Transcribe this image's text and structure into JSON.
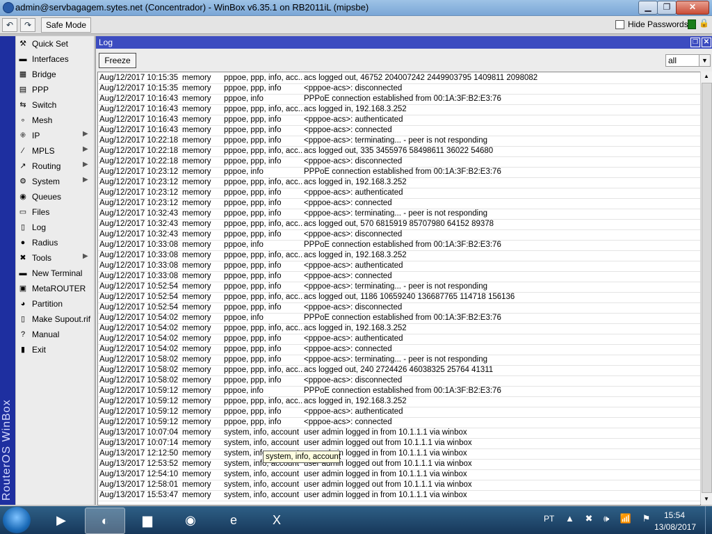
{
  "window": {
    "title": "admin@servbagagem.sytes.net (Concentrador) - WinBox v6.35.1 on RB2011iL (mipsbe)",
    "minimize": "▁",
    "maximize": "❐",
    "close": "✕"
  },
  "toolbar": {
    "undo_icon": "↶",
    "redo_icon": "↷",
    "safe_mode_label": "Safe Mode",
    "hide_passwords_label": "Hide Passwords",
    "lock_icon": "🔒"
  },
  "brand": "RouterOS WinBox",
  "sidebar": {
    "items": [
      {
        "label": "Quick Set",
        "icon": "⚒",
        "submenu": false
      },
      {
        "label": "Interfaces",
        "icon": "▬",
        "submenu": false
      },
      {
        "label": "Bridge",
        "icon": "▦",
        "submenu": false
      },
      {
        "label": "PPP",
        "icon": "▤",
        "submenu": false
      },
      {
        "label": "Switch",
        "icon": "⇆",
        "submenu": false
      },
      {
        "label": "Mesh",
        "icon": "∘",
        "submenu": false
      },
      {
        "label": "IP",
        "icon": "⁜",
        "submenu": true
      },
      {
        "label": "MPLS",
        "icon": "∕",
        "submenu": true
      },
      {
        "label": "Routing",
        "icon": "↗",
        "submenu": true
      },
      {
        "label": "System",
        "icon": "⚙",
        "submenu": true
      },
      {
        "label": "Queues",
        "icon": "◉",
        "submenu": false
      },
      {
        "label": "Files",
        "icon": "▭",
        "submenu": false
      },
      {
        "label": "Log",
        "icon": "▯",
        "submenu": false
      },
      {
        "label": "Radius",
        "icon": "●",
        "submenu": false
      },
      {
        "label": "Tools",
        "icon": "✖",
        "submenu": true
      },
      {
        "label": "New Terminal",
        "icon": "▬",
        "submenu": false
      },
      {
        "label": "MetaROUTER",
        "icon": "▣",
        "submenu": false
      },
      {
        "label": "Partition",
        "icon": "◕",
        "submenu": false
      },
      {
        "label": "Make Supout.rif",
        "icon": "▯",
        "submenu": false
      },
      {
        "label": "Manual",
        "icon": "?",
        "submenu": false
      },
      {
        "label": "Exit",
        "icon": "▮",
        "submenu": false
      }
    ],
    "submenu_arrow": "▶"
  },
  "log": {
    "title": "Log",
    "restore_icon": "❐",
    "close_icon": "✕",
    "freeze_label": "Freeze",
    "filter_value": "all",
    "filter_arrow": "▼",
    "rows": [
      [
        "Aug/12/2017 10:15:35",
        "memory",
        "pppoe, ppp, info, acc...",
        "acs logged out, 46752 204007242 2449903795 1409811 2098082"
      ],
      [
        "Aug/12/2017 10:15:35",
        "memory",
        "pppoe, ppp, info",
        "<pppoe-acs>: disconnected"
      ],
      [
        "Aug/12/2017 10:16:43",
        "memory",
        "pppoe, info",
        "PPPoE connection established from 00:1A:3F:B2:E3:76"
      ],
      [
        "Aug/12/2017 10:16:43",
        "memory",
        "pppoe, ppp, info, acc...",
        "acs logged in, 192.168.3.252"
      ],
      [
        "Aug/12/2017 10:16:43",
        "memory",
        "pppoe, ppp, info",
        "<pppoe-acs>: authenticated"
      ],
      [
        "Aug/12/2017 10:16:43",
        "memory",
        "pppoe, ppp, info",
        "<pppoe-acs>: connected"
      ],
      [
        "Aug/12/2017 10:22:18",
        "memory",
        "pppoe, ppp, info",
        "<pppoe-acs>: terminating... - peer is not responding"
      ],
      [
        "Aug/12/2017 10:22:18",
        "memory",
        "pppoe, ppp, info, acc...",
        "acs logged out, 335 3455976 58498611 36022 54680"
      ],
      [
        "Aug/12/2017 10:22:18",
        "memory",
        "pppoe, ppp, info",
        "<pppoe-acs>: disconnected"
      ],
      [
        "Aug/12/2017 10:23:12",
        "memory",
        "pppoe, info",
        "PPPoE connection established from 00:1A:3F:B2:E3:76"
      ],
      [
        "Aug/12/2017 10:23:12",
        "memory",
        "pppoe, ppp, info, acc...",
        "acs logged in, 192.168.3.252"
      ],
      [
        "Aug/12/2017 10:23:12",
        "memory",
        "pppoe, ppp, info",
        "<pppoe-acs>: authenticated"
      ],
      [
        "Aug/12/2017 10:23:12",
        "memory",
        "pppoe, ppp, info",
        "<pppoe-acs>: connected"
      ],
      [
        "Aug/12/2017 10:32:43",
        "memory",
        "pppoe, ppp, info",
        "<pppoe-acs>: terminating... - peer is not responding"
      ],
      [
        "Aug/12/2017 10:32:43",
        "memory",
        "pppoe, ppp, info, acc...",
        "acs logged out, 570 6815919 85707980 64152 89378"
      ],
      [
        "Aug/12/2017 10:32:43",
        "memory",
        "pppoe, ppp, info",
        "<pppoe-acs>: disconnected"
      ],
      [
        "Aug/12/2017 10:33:08",
        "memory",
        "pppoe, info",
        "PPPoE connection established from 00:1A:3F:B2:E3:76"
      ],
      [
        "Aug/12/2017 10:33:08",
        "memory",
        "pppoe, ppp, info, acc...",
        "acs logged in, 192.168.3.252"
      ],
      [
        "Aug/12/2017 10:33:08",
        "memory",
        "pppoe, ppp, info",
        "<pppoe-acs>: authenticated"
      ],
      [
        "Aug/12/2017 10:33:08",
        "memory",
        "pppoe, ppp, info",
        "<pppoe-acs>: connected"
      ],
      [
        "Aug/12/2017 10:52:54",
        "memory",
        "pppoe, ppp, info",
        "<pppoe-acs>: terminating... - peer is not responding"
      ],
      [
        "Aug/12/2017 10:52:54",
        "memory",
        "pppoe, ppp, info, acc...",
        "acs logged out, 1186 10659240 136687765 114718 156136"
      ],
      [
        "Aug/12/2017 10:52:54",
        "memory",
        "pppoe, ppp, info",
        "<pppoe-acs>: disconnected"
      ],
      [
        "Aug/12/2017 10:54:02",
        "memory",
        "pppoe, info",
        "PPPoE connection established from 00:1A:3F:B2:E3:76"
      ],
      [
        "Aug/12/2017 10:54:02",
        "memory",
        "pppoe, ppp, info, acc...",
        "acs logged in, 192.168.3.252"
      ],
      [
        "Aug/12/2017 10:54:02",
        "memory",
        "pppoe, ppp, info",
        "<pppoe-acs>: authenticated"
      ],
      [
        "Aug/12/2017 10:54:02",
        "memory",
        "pppoe, ppp, info",
        "<pppoe-acs>: connected"
      ],
      [
        "Aug/12/2017 10:58:02",
        "memory",
        "pppoe, ppp, info",
        "<pppoe-acs>: terminating... - peer is not responding"
      ],
      [
        "Aug/12/2017 10:58:02",
        "memory",
        "pppoe, ppp, info, acc...",
        "acs logged out, 240 2724426 46038325 25764 41311"
      ],
      [
        "Aug/12/2017 10:58:02",
        "memory",
        "pppoe, ppp, info",
        "<pppoe-acs>: disconnected"
      ],
      [
        "Aug/12/2017 10:59:12",
        "memory",
        "pppoe, info",
        "PPPoE connection established from 00:1A:3F:B2:E3:76"
      ],
      [
        "Aug/12/2017 10:59:12",
        "memory",
        "pppoe, ppp, info, acc...",
        "acs logged in, 192.168.3.252"
      ],
      [
        "Aug/12/2017 10:59:12",
        "memory",
        "pppoe, ppp, info",
        "<pppoe-acs>: authenticated"
      ],
      [
        "Aug/12/2017 10:59:12",
        "memory",
        "pppoe, ppp, info",
        "<pppoe-acs>: connected"
      ],
      [
        "Aug/13/2017 10:07:04",
        "memory",
        "system, info, account",
        "user admin logged in from 10.1.1.1 via winbox"
      ],
      [
        "Aug/13/2017 10:07:14",
        "memory",
        "system, info, account",
        "user admin logged out from 10.1.1.1 via winbox"
      ],
      [
        "Aug/13/2017 12:12:50",
        "memory",
        "system, info, account",
        "user admin logged in from 10.1.1.1 via winbox"
      ],
      [
        "Aug/13/2017 12:53:52",
        "memory",
        "system, info, account",
        "user admin logged out from 10.1.1.1 via winbox"
      ],
      [
        "Aug/13/2017 12:54:10",
        "memory",
        "system, info, account",
        "user admin logged in from 10.1.1.1 via winbox"
      ],
      [
        "Aug/13/2017 12:58:01",
        "memory",
        "system, info, account",
        "user admin logged out from 10.1.1.1 via winbox"
      ],
      [
        "Aug/13/2017 15:53:47",
        "memory",
        "system, info, account",
        "user admin logged in from 10.1.1.1 via winbox"
      ]
    ],
    "tooltip": "system, info, account",
    "scroll_up": "▲",
    "scroll_down": "▼"
  },
  "taskbar": {
    "apps": [
      {
        "name": "media",
        "icon": "▶"
      },
      {
        "name": "winbox",
        "icon": "◐"
      },
      {
        "name": "explorer",
        "icon": "▆"
      },
      {
        "name": "chrome",
        "icon": "◉"
      },
      {
        "name": "ie",
        "icon": "e"
      },
      {
        "name": "excel",
        "icon": "X"
      }
    ],
    "language": "PT",
    "tray": "▲ ✖ 🕪 📶 ⚑",
    "time": "15:54",
    "date": "13/08/2017"
  }
}
